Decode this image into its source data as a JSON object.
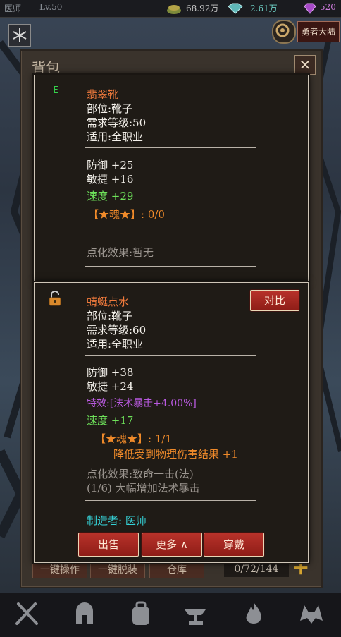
{
  "topbar": {
    "class_name": "医师",
    "level": "Lv.50",
    "gold": "68.92万",
    "diamond": "2.61万",
    "gem": "520",
    "right_button": "勇者大陆"
  },
  "bag": {
    "title": "背包",
    "close_glyph": "✕",
    "btn_batch": "一键操作",
    "btn_unequip": "一键脱装",
    "btn_warehouse": "仓库",
    "capacity": "0/72/144",
    "add_glyph": "+"
  },
  "item1": {
    "badge": "E",
    "name": "翡翠靴",
    "slot": "部位:靴子",
    "level_req": "需求等级:50",
    "class_req": "适用:全职业",
    "defense": "防御 +25",
    "agility": "敏捷 +16",
    "speed": "速度 +29",
    "soul": "【★魂★】: 0/0",
    "enchant": "点化效果:暂无"
  },
  "item2": {
    "name": "蜻蜓点水",
    "compare_button": "对比",
    "slot": "部位:靴子",
    "level_req": "需求等级:60",
    "class_req": "适用:全职业",
    "defense": "防御 +38",
    "agility": "敏捷 +24",
    "special": "特效:[法术暴击+4.00%]",
    "speed": "速度 +17",
    "soul": "【★魂★】: 1/1",
    "soul_effect": "降低受到物理伤害结果 +1",
    "enchant": "点化效果:致命一击(法)",
    "enchant_desc": "(1/6) 大幅增加法术暴击",
    "maker": "制造者: 医师",
    "btn_sell": "出售",
    "btn_more": "更多 ∧",
    "btn_equip": "穿戴"
  },
  "colors": {
    "item_name": "#f07a3c",
    "green_stat": "#6ee25a",
    "special": "#b95ae0",
    "maker": "#35d0d5",
    "button_red": "#a8281f"
  }
}
